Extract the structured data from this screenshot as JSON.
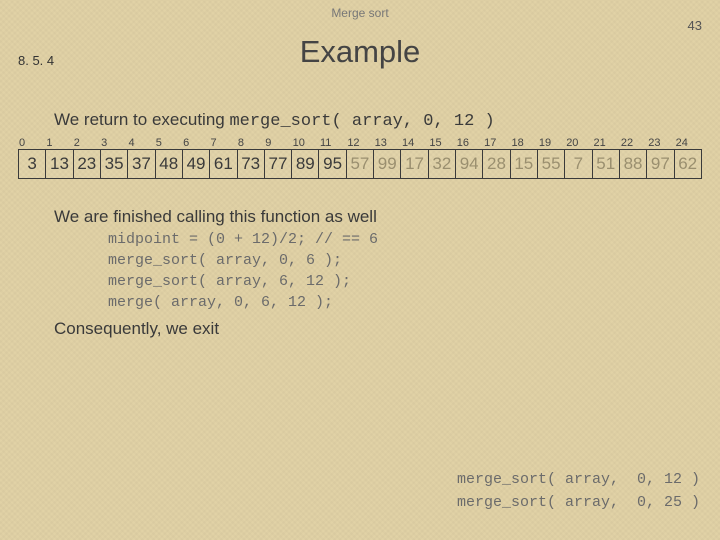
{
  "header": {
    "title": "Merge sort",
    "page_number": "43",
    "section": "8. 5. 4"
  },
  "title": "Example",
  "intro": {
    "prefix": "We return to executing ",
    "code": "merge_sort( array, 0, 12 )"
  },
  "array": {
    "indices": [
      "0",
      "1",
      "2",
      "3",
      "4",
      "5",
      "6",
      "7",
      "8",
      "9",
      "10",
      "11",
      "12",
      "13",
      "14",
      "15",
      "16",
      "17",
      "18",
      "19",
      "20",
      "21",
      "22",
      "23",
      "24"
    ],
    "values": [
      "3",
      "13",
      "23",
      "35",
      "37",
      "48",
      "49",
      "61",
      "73",
      "77",
      "89",
      "95",
      "57",
      "99",
      "17",
      "32",
      "94",
      "28",
      "15",
      "55",
      "7",
      "51",
      "88",
      "97",
      "62"
    ],
    "dim_from": 12
  },
  "note1": "We are finished calling this function as well",
  "code_lines": [
    "midpoint = (0 + 12)/2; // == 6",
    "merge_sort( array, 0, 6 );",
    "merge_sort( array, 6, 12 );",
    "merge( array, 0, 6, 12 );"
  ],
  "note2": "Consequently, we exit",
  "call_stack": [
    "merge_sort( array,  0, 12 )",
    "merge_sort( array,  0, 25 )"
  ]
}
